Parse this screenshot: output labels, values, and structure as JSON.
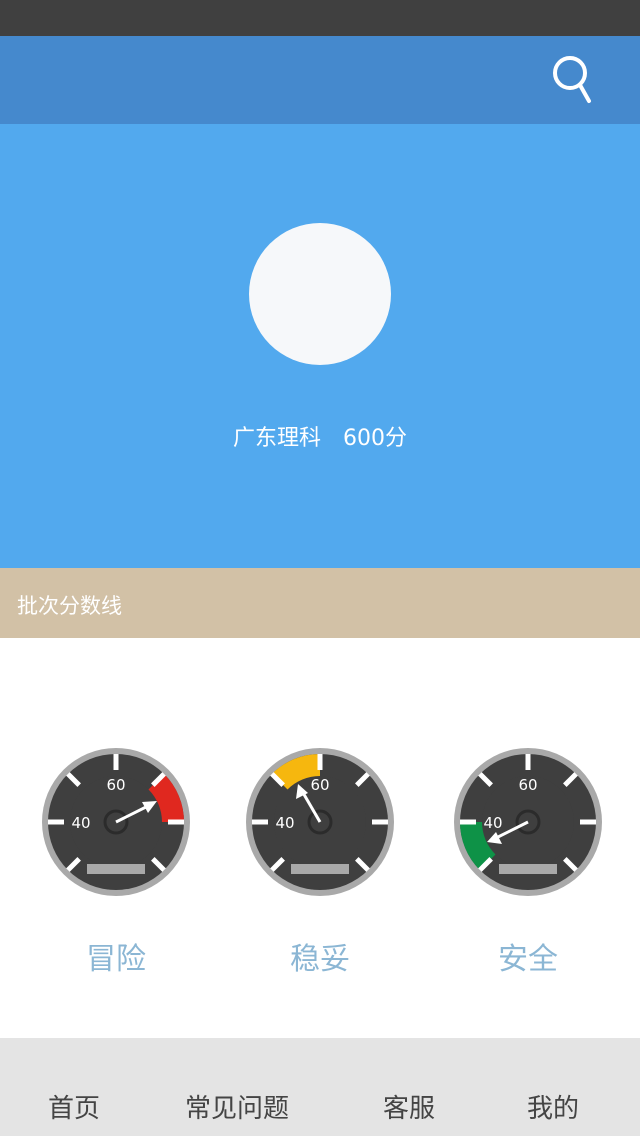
{
  "header": {
    "search_icon": "search-icon",
    "bar_color": "#4589cd"
  },
  "profile": {
    "region": "广东理科",
    "score": "600分",
    "hero_color": "#52a9ee"
  },
  "section": {
    "title": "批次分数线",
    "color": "#d2c1a6"
  },
  "gauges": [
    {
      "label": "冒险",
      "ticks": [
        "40",
        "60"
      ],
      "zone_color": "#e0281f"
    },
    {
      "label": "稳妥",
      "ticks": [
        "40",
        "60"
      ],
      "zone_color": "#f6b70e"
    },
    {
      "label": "安全",
      "ticks": [
        "40",
        "60"
      ],
      "zone_color": "#0e9247"
    }
  ],
  "tabs": [
    {
      "label": "首页"
    },
    {
      "label": "常见问题"
    },
    {
      "label": "客服"
    },
    {
      "label": "我的"
    }
  ]
}
